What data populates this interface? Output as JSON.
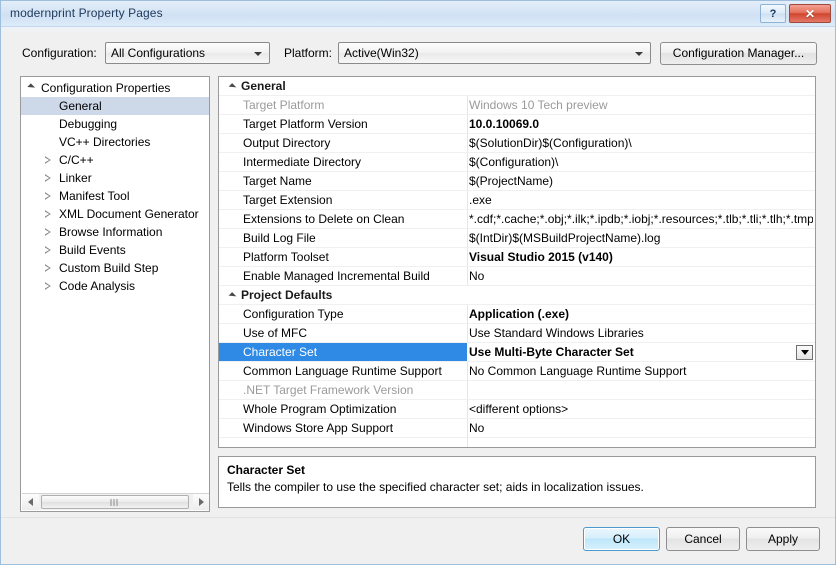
{
  "window": {
    "title": "modernprint Property Pages",
    "help_button": "?",
    "close_button": "✕",
    "accent_blue": "#2e8ae5",
    "titlebar_text_color": "#1e395b"
  },
  "config_bar": {
    "configuration_label": "Configuration:",
    "configuration_value": "All Configurations",
    "platform_label": "Platform:",
    "platform_value": "Active(Win32)",
    "config_manager_button": "Configuration Manager..."
  },
  "tree": {
    "items": [
      {
        "label": "Configuration Properties",
        "depth": 0,
        "state": "expanded",
        "selected": false
      },
      {
        "label": "General",
        "depth": 1,
        "state": "leaf",
        "selected": true
      },
      {
        "label": "Debugging",
        "depth": 1,
        "state": "leaf",
        "selected": false
      },
      {
        "label": "VC++ Directories",
        "depth": 1,
        "state": "leaf",
        "selected": false
      },
      {
        "label": "C/C++",
        "depth": 1,
        "state": "collapsed",
        "selected": false
      },
      {
        "label": "Linker",
        "depth": 1,
        "state": "collapsed",
        "selected": false
      },
      {
        "label": "Manifest Tool",
        "depth": 1,
        "state": "collapsed",
        "selected": false
      },
      {
        "label": "XML Document Generator",
        "depth": 1,
        "state": "collapsed",
        "selected": false
      },
      {
        "label": "Browse Information",
        "depth": 1,
        "state": "collapsed",
        "selected": false
      },
      {
        "label": "Build Events",
        "depth": 1,
        "state": "collapsed",
        "selected": false
      },
      {
        "label": "Custom Build Step",
        "depth": 1,
        "state": "collapsed",
        "selected": false
      },
      {
        "label": "Code Analysis",
        "depth": 1,
        "state": "collapsed",
        "selected": false
      }
    ]
  },
  "grid": {
    "rows": [
      {
        "kind": "category",
        "name": "General"
      },
      {
        "kind": "prop",
        "name": "Target Platform",
        "value": "Windows 10 Tech preview",
        "disabled": true,
        "bold": false,
        "selected": false
      },
      {
        "kind": "prop",
        "name": "Target Platform Version",
        "value": "10.0.10069.0",
        "disabled": false,
        "bold": true,
        "selected": false
      },
      {
        "kind": "prop",
        "name": "Output Directory",
        "value": "$(SolutionDir)$(Configuration)\\",
        "disabled": false,
        "bold": false,
        "selected": false
      },
      {
        "kind": "prop",
        "name": "Intermediate Directory",
        "value": "$(Configuration)\\",
        "disabled": false,
        "bold": false,
        "selected": false
      },
      {
        "kind": "prop",
        "name": "Target Name",
        "value": "$(ProjectName)",
        "disabled": false,
        "bold": false,
        "selected": false
      },
      {
        "kind": "prop",
        "name": "Target Extension",
        "value": ".exe",
        "disabled": false,
        "bold": false,
        "selected": false
      },
      {
        "kind": "prop",
        "name": "Extensions to Delete on Clean",
        "value": "*.cdf;*.cache;*.obj;*.ilk;*.ipdb;*.iobj;*.resources;*.tlb;*.tli;*.tlh;*.tmp",
        "disabled": false,
        "bold": false,
        "selected": false
      },
      {
        "kind": "prop",
        "name": "Build Log File",
        "value": "$(IntDir)$(MSBuildProjectName).log",
        "disabled": false,
        "bold": false,
        "selected": false
      },
      {
        "kind": "prop",
        "name": "Platform Toolset",
        "value": "Visual Studio 2015 (v140)",
        "disabled": false,
        "bold": true,
        "selected": false
      },
      {
        "kind": "prop",
        "name": "Enable Managed Incremental Build",
        "value": "No",
        "disabled": false,
        "bold": false,
        "selected": false
      },
      {
        "kind": "category",
        "name": "Project Defaults"
      },
      {
        "kind": "prop",
        "name": "Configuration Type",
        "value": "Application (.exe)",
        "disabled": false,
        "bold": true,
        "selected": false
      },
      {
        "kind": "prop",
        "name": "Use of MFC",
        "value": "Use Standard Windows Libraries",
        "disabled": false,
        "bold": false,
        "selected": false
      },
      {
        "kind": "prop",
        "name": "Character Set",
        "value": "Use Multi-Byte Character Set",
        "disabled": false,
        "bold": true,
        "selected": true
      },
      {
        "kind": "prop",
        "name": "Common Language Runtime Support",
        "value": "No Common Language Runtime Support",
        "disabled": false,
        "bold": false,
        "selected": false
      },
      {
        "kind": "prop",
        "name": ".NET Target Framework Version",
        "value": "",
        "disabled": true,
        "bold": false,
        "selected": false
      },
      {
        "kind": "prop",
        "name": "Whole Program Optimization",
        "value": "<different options>",
        "disabled": false,
        "bold": false,
        "selected": false
      },
      {
        "kind": "prop",
        "name": "Windows Store App Support",
        "value": "No",
        "disabled": false,
        "bold": false,
        "selected": false
      }
    ],
    "dropdown_icon": "chevron-down-icon"
  },
  "description": {
    "title": "Character Set",
    "body": "Tells the compiler to use the specified character set; aids in localization issues."
  },
  "footer": {
    "ok": "OK",
    "cancel": "Cancel",
    "apply": "Apply"
  }
}
